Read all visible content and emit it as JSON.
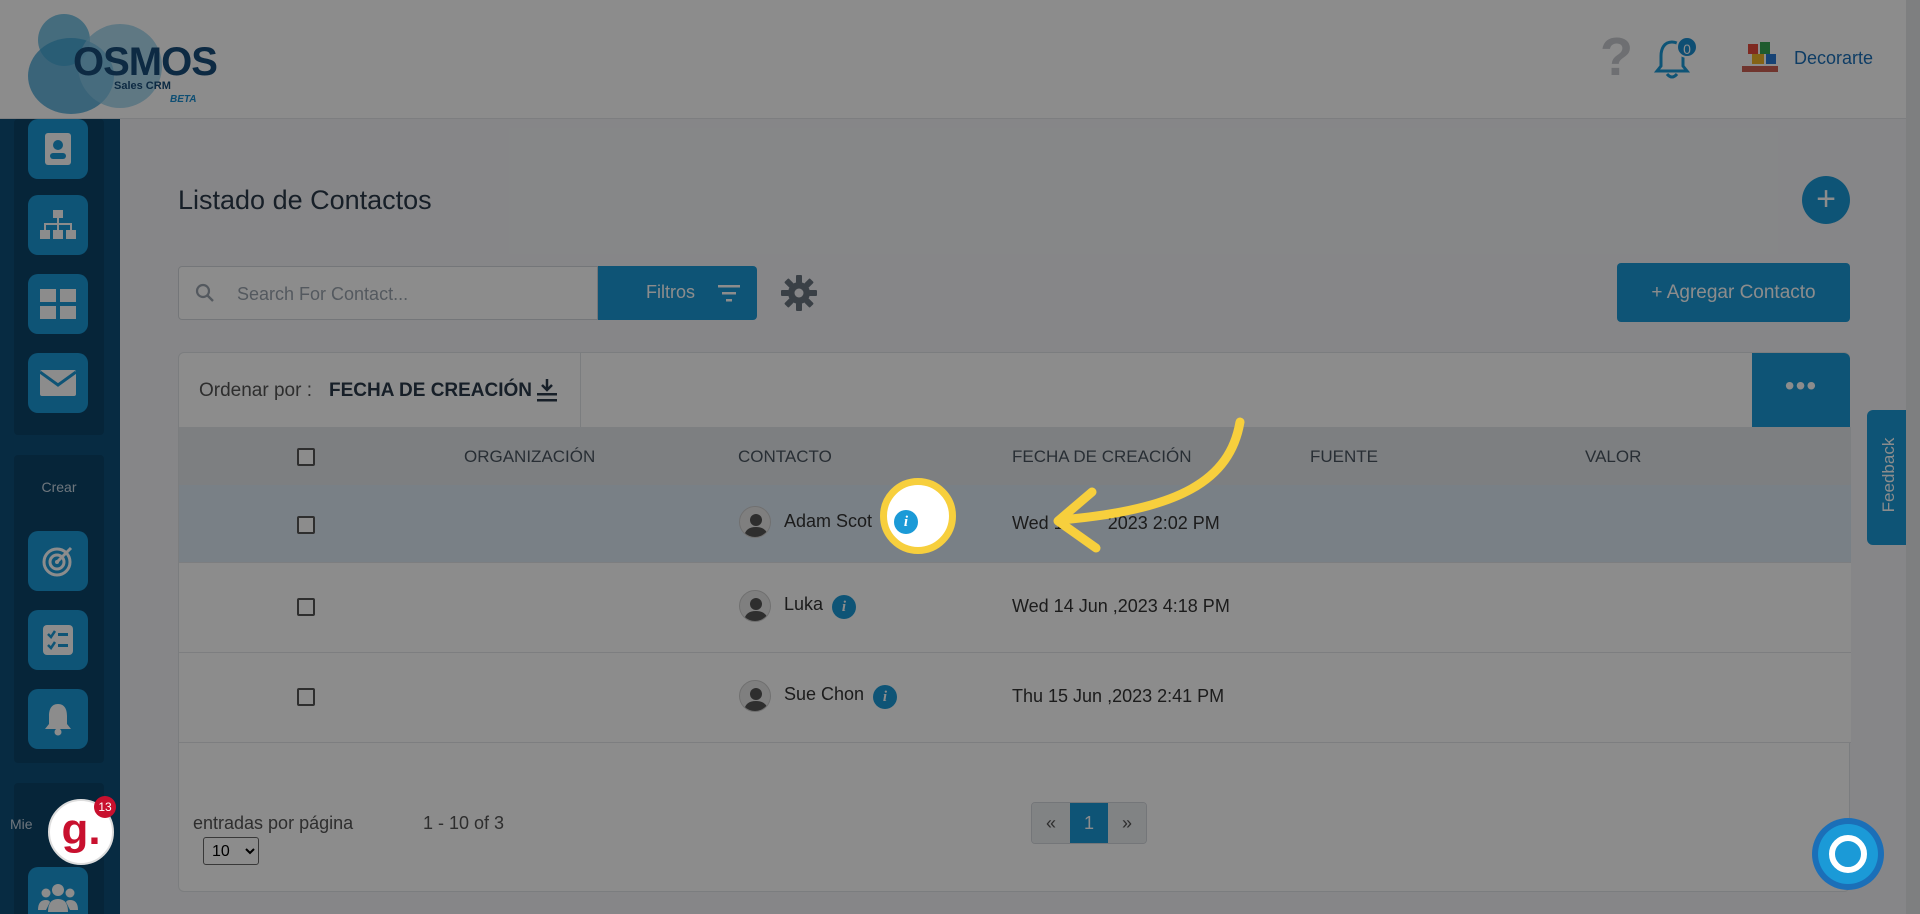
{
  "header": {
    "logo_text": "OSMOS",
    "logo_sub": "Sales CRM",
    "logo_beta": "BETA",
    "help_icon": "question-icon",
    "notification_count": "0",
    "company_name": "Decorarte"
  },
  "sidebar": {
    "crear_label": "Crear",
    "mie_label": "Mie",
    "icons_top": [
      "contact-card-icon",
      "org-chart-icon",
      "dashboard-icon",
      "mail-icon"
    ],
    "icons_create": [
      "target-icon",
      "checklist-icon",
      "bell-icon"
    ],
    "icons_bottom": [
      "users-icon"
    ]
  },
  "main": {
    "title": "Listado de Contactos",
    "search_placeholder": "Search For Contact...",
    "filter_label": "Filtros",
    "add_contact_label": "+ Agregar Contacto",
    "sort_label": "Ordenar por :",
    "sort_value": "FECHA DE CREACIÓN"
  },
  "table": {
    "columns": [
      "ORGANIZACIÓN",
      "CONTACTO",
      "FECHA DE CREACIÓN",
      "FUENTE",
      "VALOR"
    ],
    "rows": [
      {
        "contact": "Adam Scot",
        "date": "Wed 1",
        "date_tail": "2023 2:02 PM",
        "selected": true
      },
      {
        "contact": "Luka",
        "date": "Wed 14 Jun ,2023 4:18 PM",
        "selected": false
      },
      {
        "contact": "Sue Chon",
        "date": "Thu 15 Jun ,2023 2:41 PM",
        "selected": false
      }
    ]
  },
  "pagination": {
    "per_page_label": "entradas por página",
    "per_page_value": "10",
    "range": "1 - 10 of 3",
    "prev": "«",
    "current": "1",
    "next": "»"
  },
  "feedback_label": "Feedback",
  "grammarly": {
    "letter": "g.",
    "badge": "13"
  },
  "colors": {
    "accent": "#1b9ad7",
    "highlight": "#f7cf3d",
    "sidebar": "#0e4f78"
  }
}
